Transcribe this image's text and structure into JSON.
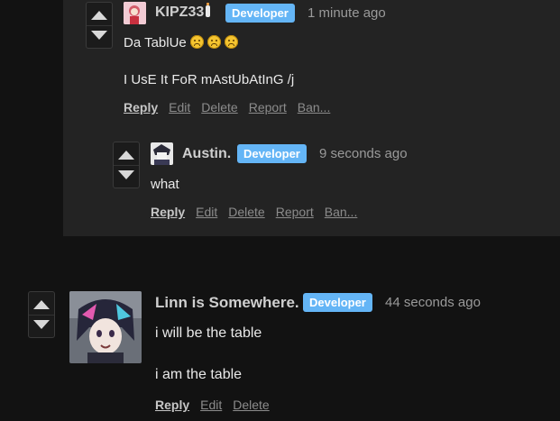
{
  "comments": [
    {
      "username": "KIPZ33",
      "badge": "Developer",
      "time": "1 minute ago",
      "lines": [
        "Da TablUe",
        "I UsE It FoR mAstUbAtInG /j"
      ],
      "actions": [
        "Reply",
        "Edit",
        "Delete",
        "Report",
        "Ban..."
      ]
    },
    {
      "username": "Austin.",
      "badge": "Developer",
      "time": "9 seconds ago",
      "lines": [
        "what"
      ],
      "actions": [
        "Reply",
        "Edit",
        "Delete",
        "Report",
        "Ban..."
      ]
    },
    {
      "username": "Linn is Somewhere.",
      "badge": "Developer",
      "time": "44 seconds ago",
      "lines": [
        "i will be the table",
        "i am the table"
      ],
      "actions": [
        "Reply",
        "Edit",
        "Delete"
      ]
    }
  ],
  "colors": {
    "badge": "#64b5f6",
    "panel": "#232323",
    "page": "#121212"
  },
  "icons": {
    "vote_up": "triangle-up-icon",
    "vote_down": "triangle-down-icon",
    "emoji": "frowning-face-icon",
    "bottle": "baby-bottle-icon"
  }
}
